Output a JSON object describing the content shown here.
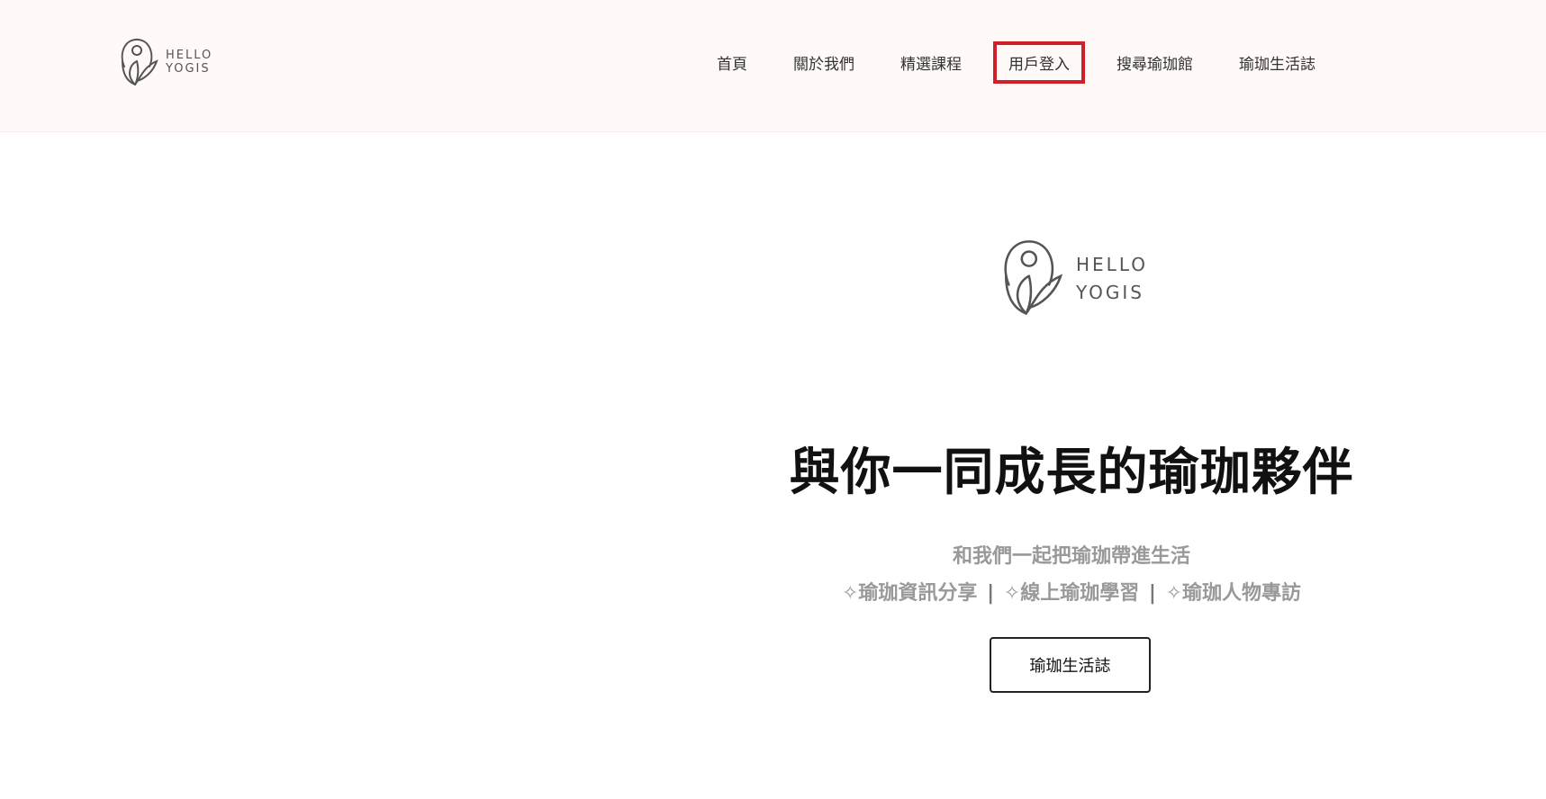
{
  "brand": {
    "line1": "HELLO",
    "line2": "YOGIS"
  },
  "nav": {
    "items": [
      {
        "label": "首頁"
      },
      {
        "label": "關於我們"
      },
      {
        "label": "精選課程"
      },
      {
        "label": "用戶登入"
      },
      {
        "label": "搜尋瑜珈館"
      },
      {
        "label": "瑜珈生活誌"
      }
    ]
  },
  "hero": {
    "title": "與你一同成長的瑜珈夥伴",
    "subtitle": "和我們一起把瑜珈帶進生活",
    "features": [
      "✧瑜珈資訊分享",
      "✧線上瑜珈學習",
      "✧瑜珈人物專訪"
    ],
    "separator": "|",
    "cta_label": "瑜珈生活誌"
  },
  "colors": {
    "header_bg": "#fff9f8",
    "highlight_border": "#d0202a",
    "muted_text": "#999999"
  }
}
